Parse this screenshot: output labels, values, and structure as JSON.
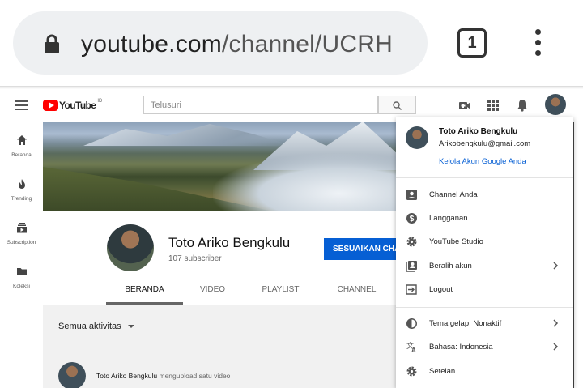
{
  "browser": {
    "url_domain": "youtube.com",
    "url_path": "/channel/UCRH",
    "tab_count": "1"
  },
  "header": {
    "logo_text": "YouTube",
    "logo_region": "ID",
    "search_placeholder": "Telusuri"
  },
  "sidebar": {
    "items": [
      {
        "label": "Beranda",
        "icon": "home-icon"
      },
      {
        "label": "Trending",
        "icon": "flame-icon"
      },
      {
        "label": "Subscription",
        "icon": "subscriptions-icon"
      },
      {
        "label": "Koleksi",
        "icon": "folder-icon"
      }
    ]
  },
  "channel": {
    "name": "Toto Ariko Bengkulu",
    "subscribers": "107 subscriber",
    "customize_button": "SESUAIKAN CHANNEL",
    "tabs": [
      "BERANDA",
      "VIDEO",
      "PLAYLIST",
      "CHANNEL"
    ],
    "active_tab": "BERANDA"
  },
  "feed": {
    "filter_label": "Semua aktivitas",
    "item_author": "Toto Ariko Bengkulu",
    "item_action": " mengupload satu video"
  },
  "account_menu": {
    "name": "Toto Ariko Bengkulu",
    "email": "Arikobengkulu@gmail.com",
    "manage_link": "Kelola Akun Google Anda",
    "items": [
      {
        "label": "Channel Anda",
        "icon": "account-box-icon",
        "has_chevron": false
      },
      {
        "label": "Langganan",
        "icon": "dollar-icon",
        "has_chevron": false
      },
      {
        "label": "YouTube Studio",
        "icon": "gear-icon",
        "has_chevron": false
      },
      {
        "label": "Beralih akun",
        "icon": "switch-account-icon",
        "has_chevron": true
      },
      {
        "label": "Logout",
        "icon": "logout-icon",
        "has_chevron": false
      },
      {
        "label": "Tema gelap: Nonaktif",
        "icon": "dark-theme-icon",
        "has_chevron": true
      },
      {
        "label": "Bahasa: Indonesia",
        "icon": "translate-icon",
        "has_chevron": true
      },
      {
        "label": "Setelan",
        "icon": "settings-icon",
        "has_chevron": false
      }
    ]
  },
  "colors": {
    "brand_red": "#ff0000",
    "accent_blue": "#065fd4"
  }
}
